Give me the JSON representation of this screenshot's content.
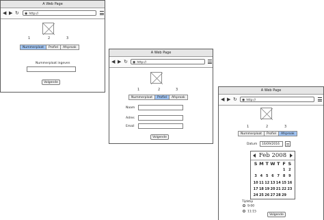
{
  "browser": {
    "title": "A Web Page",
    "url": "http://"
  },
  "steps": [
    "1",
    "2",
    "3"
  ],
  "tabs": [
    "Nummerploat",
    "Profiel",
    "Afsproak"
  ],
  "screen1": {
    "active_tab": 0,
    "field_label": "Nummerploat ingeven",
    "field_value": "",
    "next_label": "Volgende"
  },
  "screen2": {
    "active_tab": 1,
    "fields": [
      {
        "label": "Naam",
        "value": ""
      },
      {
        "label": "Adres",
        "value": ""
      },
      {
        "label": "Email",
        "value": ""
      }
    ],
    "next_label": "Volgende"
  },
  "screen3": {
    "active_tab": 2,
    "date_label": "Datum",
    "date_value": "16/09/2016",
    "calendar": {
      "month_label": "Feb 2008",
      "weekdays": [
        "S",
        "M",
        "T",
        "W",
        "T",
        "F",
        "S"
      ],
      "days": [
        "",
        "",
        "",
        "",
        "",
        "1",
        "2",
        "3",
        "4",
        "5",
        "6",
        "7",
        "8",
        "9",
        "10",
        "11",
        "12",
        "13",
        "14",
        "15",
        "16",
        "17",
        "18",
        "19",
        "20",
        "21",
        "22",
        "23",
        "24",
        "25",
        "26",
        "27",
        "28",
        "29",
        ""
      ]
    },
    "time_label": "Tijdstip",
    "time_options": [
      "9:00",
      "11:15"
    ],
    "next_label": "Volgende"
  },
  "colors": {
    "active_tab": "#9fc3f2",
    "window_border": "#5a5a5a",
    "titlebar": "#e6e6e6"
  },
  "icons": {
    "back": "arrow-left-icon",
    "forward": "arrow-right-icon",
    "reload": "reload-icon",
    "menu": "hamburger-menu-icon",
    "image": "image-placeholder-icon",
    "calendar": "calendar-icon"
  }
}
